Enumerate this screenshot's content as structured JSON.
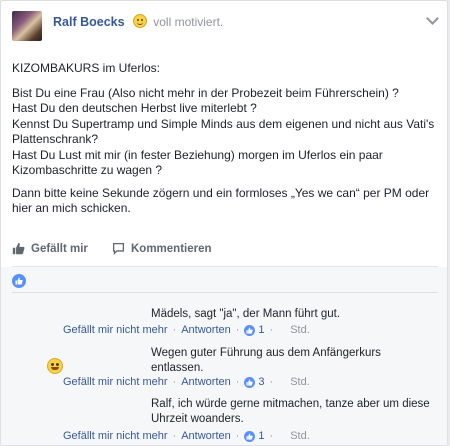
{
  "post": {
    "author": "Ralf Boecks",
    "feeling": "voll motiviert.",
    "heading": "KIZOMBAKURS im Uferlos:",
    "paragraph1": "Bist Du eine Frau (Also nicht mehr in der Probezeit beim Führerschein) ?\nHast Du den deutschen Herbst live miterlebt ?\nKennst Du Supertramp und Simple Minds aus dem eigenen und nicht aus Vati's Plattenschrank?\nHast Du Lust mit mir (in fester Beziehung) morgen im Uferlos ein paar Kizombaschritte zu wagen ?",
    "paragraph2": "Dann bitte keine Sekunde zögern und ein formloses „Yes we can“ per PM oder hier an mich schicken."
  },
  "actions": {
    "like": "Gefällt mir",
    "comment": "Kommentieren"
  },
  "comments": [
    {
      "text": "Mädels, sagt \"ja\", der Mann führt gut.",
      "unlike": "Gefällt mir nicht mehr",
      "reply": "Antworten",
      "likes": "1",
      "time": "Std."
    },
    {
      "text": "Wegen guter Führung aus dem Anfängerkurs entlassen.",
      "emoji": "grinning-emoji",
      "unlike": "Gefällt mir nicht mehr",
      "reply": "Antworten",
      "likes": "3",
      "time": "Std."
    },
    {
      "text": "Ralf, ich würde gerne mitmachen, tanze aber um diese Uhrzeit woanders.",
      "unlike": "Gefällt mir nicht mehr",
      "reply": "Antworten",
      "likes": "1",
      "time": "Std."
    }
  ],
  "colors": {
    "link": "#365899",
    "meta": "#90949c",
    "like_badge": "#5890ff"
  }
}
